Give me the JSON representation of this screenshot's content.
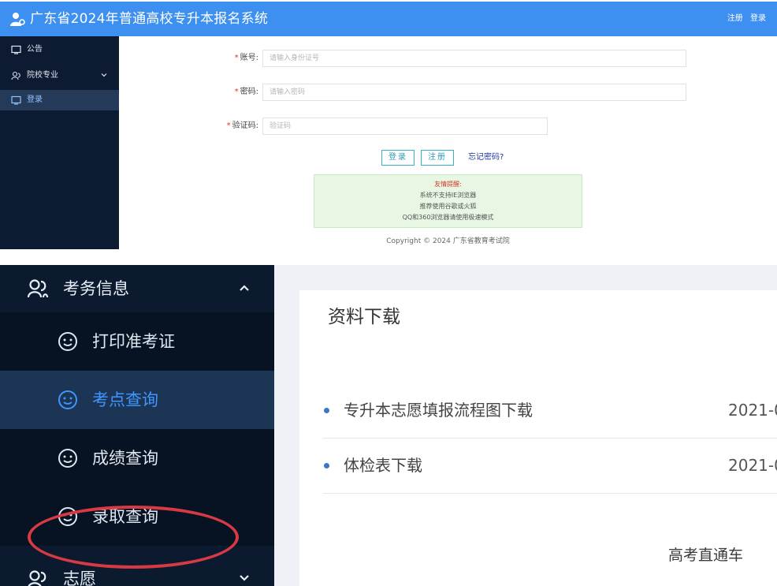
{
  "header": {
    "title": "广东省2024年普通高校专升本报名系统",
    "register_link": "注册",
    "login_link": "登录",
    "bg_color": "#3d8ff0"
  },
  "small_sidebar": {
    "items": [
      {
        "label": "公告",
        "icon": "monitor-icon",
        "active": false
      },
      {
        "label": "院校专业",
        "icon": "user-group-icon",
        "active": false,
        "has_chevron": true
      },
      {
        "label": "登录",
        "icon": "monitor-icon",
        "active": true
      }
    ]
  },
  "login_form": {
    "account_label": "账号:",
    "account_placeholder": "请输入身份证号",
    "password_label": "密码:",
    "password_placeholder": "请输入密码",
    "captcha_label": "验证码:",
    "captcha_placeholder": "验证码",
    "login_button": "登录",
    "register_button": "注册",
    "forgot_link": "忘记密码?"
  },
  "notice": {
    "title": "友情提醒:",
    "lines": [
      "系统不支持IE浏览器",
      "推荐使用谷歌或火狐",
      "QQ和360浏览器请使用极速模式"
    ]
  },
  "copyright": "Copyright © 2024 广东省教育考试院",
  "big_sidebar": {
    "group_label": "考务信息",
    "items": [
      {
        "label": "打印准考证",
        "icon": "smiley-icon",
        "active": false
      },
      {
        "label": "考点查询",
        "icon": "smiley-icon",
        "active": true
      },
      {
        "label": "成绩查询",
        "icon": "smiley-icon",
        "active": false
      },
      {
        "label": "录取查询",
        "icon": "smiley-icon",
        "active": false,
        "circled": true
      }
    ],
    "group2_label": "志愿"
  },
  "downloads": {
    "title": "资料下载",
    "items": [
      {
        "name": "专升本志愿填报流程图下载",
        "date": "2021-0"
      },
      {
        "name": "体检表下载",
        "date": "2021-0"
      }
    ]
  },
  "watermark": "高考直通车",
  "colors": {
    "sidebar_dark": "#0b1a2e",
    "active_item": "#1d3554",
    "active_text": "#3f95ff",
    "highlight_ring": "#d73a44"
  }
}
